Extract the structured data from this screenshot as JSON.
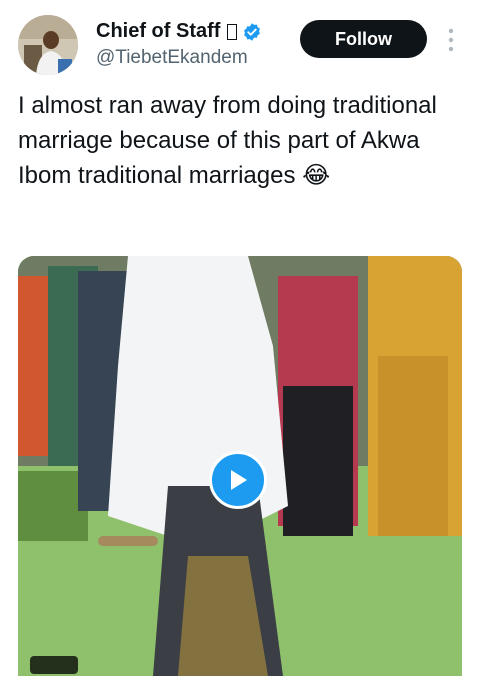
{
  "author": {
    "name": "Chief of Staff",
    "handle": "@TiebetEkandem",
    "verified": true,
    "verified_color": "#1d9bf0",
    "name_trailing_glyph": "missing-glyph-box"
  },
  "follow_button": {
    "label": "Follow"
  },
  "tweet": {
    "text": "I almost ran away from doing traditional marriage because of this part of Akwa Ibom traditional marriages 😂"
  },
  "media": {
    "type": "video",
    "play_icon": "play-icon",
    "accent": "#1d9bf0"
  },
  "icons": {
    "more": "more-vertical-icon",
    "verified": "verified-badge-icon"
  }
}
